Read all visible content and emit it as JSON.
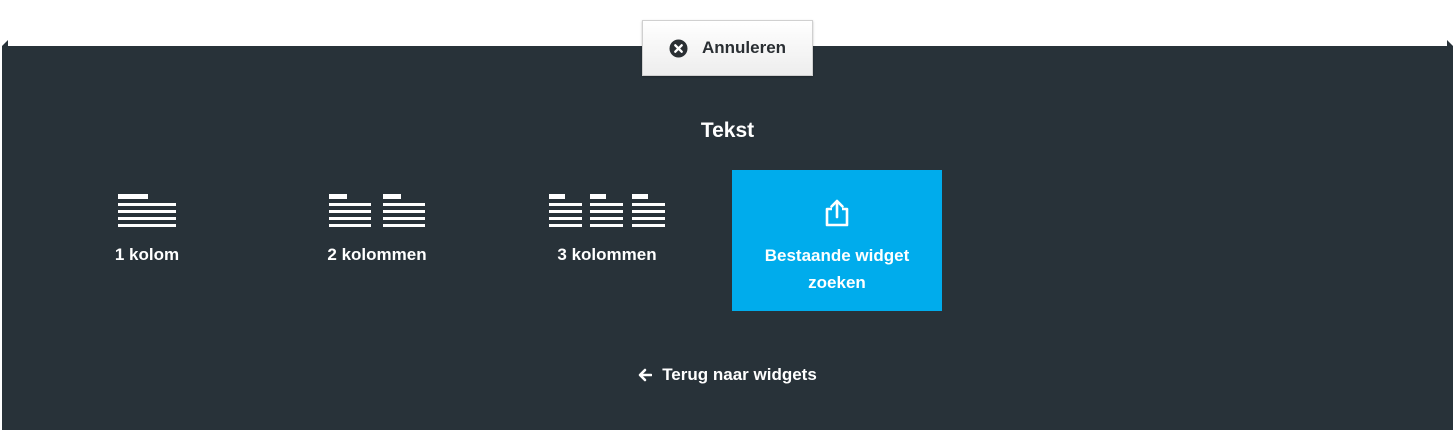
{
  "cancel": {
    "label": "Annuleren",
    "icon": "close-circle-icon"
  },
  "section": {
    "title": "Tekst"
  },
  "options": [
    {
      "label": "1 kolom",
      "icon": "one-column-text-icon"
    },
    {
      "label": "2 kolommen",
      "icon": "two-column-text-icon"
    },
    {
      "label": "3 kolommen",
      "icon": "three-column-text-icon"
    },
    {
      "label": "Bestaande widget zoeken",
      "icon": "share-export-icon"
    }
  ],
  "back": {
    "label": "Terug naar widgets",
    "icon": "arrow-left-icon"
  },
  "colors": {
    "panel_bg": "#283239",
    "accent": "#00acec",
    "text_light": "#ffffff",
    "button_text": "#2a2f33"
  }
}
